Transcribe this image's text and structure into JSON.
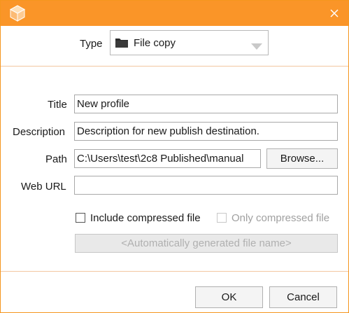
{
  "dialog": {
    "accent_color": "#fa9528",
    "app_icon": "cube-icon",
    "close_icon": "close-icon"
  },
  "type": {
    "label": "Type",
    "selected": "File copy",
    "icon": "folder-icon"
  },
  "form": {
    "title_label": "Title",
    "title_value": "New profile",
    "description_label": "Description",
    "description_value": "Description for new publish destination.",
    "path_label": "Path",
    "path_value": "C:\\Users\\test\\2c8 Published\\manual",
    "browse_label": "Browse...",
    "weburl_label": "Web URL",
    "weburl_value": ""
  },
  "options": {
    "include_compressed_label": "Include compressed file",
    "include_compressed_checked": false,
    "only_compressed_label": "Only compressed file",
    "only_compressed_checked": false,
    "only_compressed_enabled": false,
    "filename_placeholder": "<Automatically generated file name>"
  },
  "footer": {
    "ok_label": "OK",
    "cancel_label": "Cancel"
  }
}
